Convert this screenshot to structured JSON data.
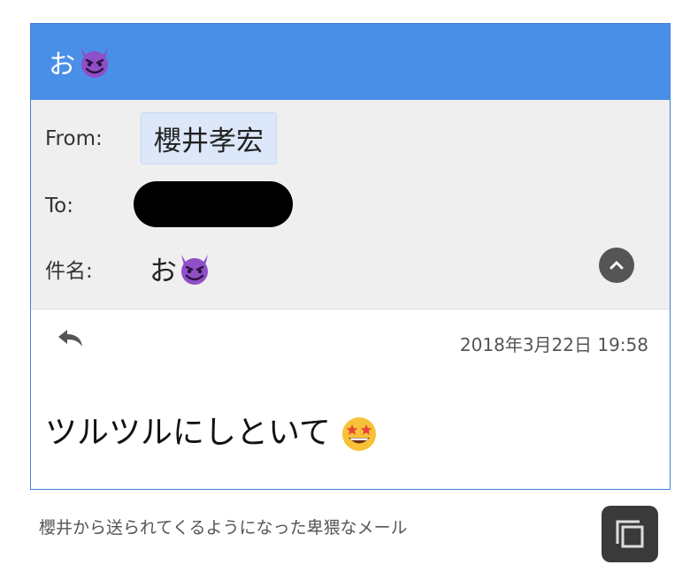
{
  "window": {
    "title": "お",
    "title_icon": "smiling-devil-emoji-icon"
  },
  "header": {
    "from_label": "From:",
    "from_value": "櫻井孝宏",
    "to_label": "To:",
    "to_value_redacted": true,
    "subject_label": "件名:",
    "subject_value": "お",
    "subject_icon": "smiling-devil-emoji-icon",
    "collapse_icon": "chevron-up-icon"
  },
  "message": {
    "reply_icon": "reply-arrow-icon",
    "timestamp": "2018年3月22日 19:58",
    "body": "ツルツルにしといて",
    "body_icon": "star-struck-emoji-icon"
  },
  "caption": {
    "text": "櫻井から送られてくるようになった卑猥なメール",
    "copy_icon": "copy-icon"
  },
  "colors": {
    "titlebar": "#4a8fe7",
    "header_bg": "#efefef",
    "chip_bg": "#dce8fa"
  }
}
